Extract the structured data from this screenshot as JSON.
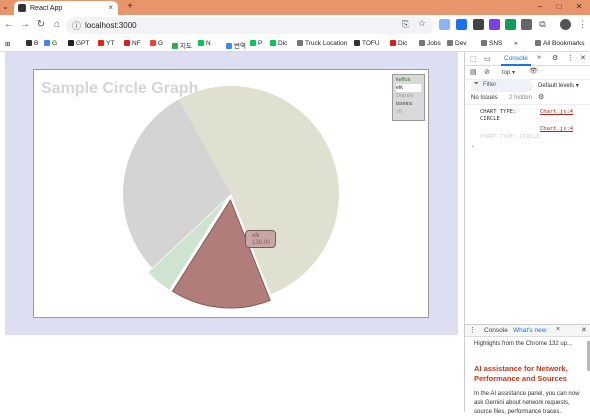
{
  "browser": {
    "tab_title": "React App",
    "new_tab": "+",
    "url": "localhost:3000",
    "window_minimize": "–",
    "window_maximize": "□",
    "window_close": "✕"
  },
  "bookmarks": [
    {
      "label": "B",
      "color": "#333333"
    },
    {
      "label": "G",
      "color": "#4285f4"
    },
    {
      "label": "GPT",
      "color": "#222222"
    },
    {
      "label": "YT",
      "color": "#e62117"
    },
    {
      "label": "NF",
      "color": "#d81f26"
    },
    {
      "label": "G",
      "color": "#ea4335"
    },
    {
      "label": "지도",
      "color": "#34a853"
    },
    {
      "label": "N",
      "color": "#03c75a"
    },
    {
      "label": "번역",
      "color": "#4285f4"
    },
    {
      "label": "P",
      "color": "#03c75a"
    },
    {
      "label": "Dic",
      "color": "#03c75a"
    },
    {
      "label": "Truck Location",
      "color": "#777777"
    },
    {
      "label": "TOFU",
      "color": "#333333"
    },
    {
      "label": "Dic",
      "color": "#d81f26"
    },
    {
      "label": "Jobs",
      "color": "#777777"
    },
    {
      "label": "Dev",
      "color": "#777777"
    },
    {
      "label": "SNS",
      "color": "#777777"
    },
    {
      "label": "»",
      "color": "#ffffff"
    },
    {
      "label": "All Bookmarks",
      "color": "#777777"
    }
  ],
  "page": {
    "chart_title": "Sample Circle Graph",
    "legend": [
      "kelfus",
      "elk",
      "Dopshi",
      "isseira",
      "sB"
    ],
    "tooltip_label": "elk",
    "tooltip_value": "138.00"
  },
  "colors": {
    "slice_large": "#dfe0d0",
    "slice_red": "#b17d7a",
    "slice_green": "#cfe4d0",
    "slice_gray": "#d4d4d4",
    "page_bg": "#dedef2"
  },
  "devtools": {
    "console_tab": "Console",
    "context": "top",
    "filter_placeholder": "Filter",
    "levels": "Default levels",
    "no_issues": "No Issues",
    "hidden": "2 hidden",
    "log1": "CHART TYPE:",
    "log1_value": "CIRCLE",
    "log1_src": "Chart.js:4",
    "log2_src": "Chart.js:4",
    "log3": "CHART TYPE: CIRCLE",
    "prompt": "›",
    "drawer_console": "Console",
    "drawer_whatsnew": "What's new",
    "highlights": "Highlights from the Chrome 132 up...",
    "ai_title": "AI assistance for Network, Performance and Sources",
    "ai_body": "In the AI assistance panel, you can now ask Gemini about network requests, source files, performance traces."
  },
  "chart_data": {
    "type": "pie",
    "title": "Sample Circle Graph",
    "categories": [
      "kelfus",
      "elk",
      "Dopshi",
      "isseira",
      "sB"
    ],
    "values": [
      52,
      15,
      4,
      29,
      0
    ],
    "legend_position": "top-right"
  }
}
